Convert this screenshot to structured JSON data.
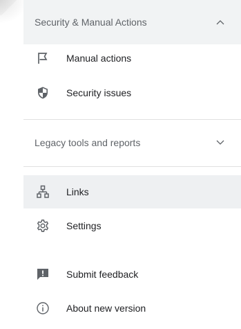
{
  "sections": {
    "security": {
      "title": "Security & Manual Actions",
      "state": "expanded",
      "items": [
        {
          "label": "Manual actions",
          "icon": "flag-icon"
        },
        {
          "label": "Security issues",
          "icon": "shield-icon"
        }
      ]
    },
    "legacy": {
      "title": "Legacy tools and reports",
      "state": "collapsed"
    }
  },
  "nav": {
    "links": {
      "label": "Links",
      "icon": "sitemap-icon",
      "active": true
    },
    "settings": {
      "label": "Settings",
      "icon": "gear-icon"
    },
    "feedback": {
      "label": "Submit feedback",
      "icon": "feedback-icon"
    },
    "about": {
      "label": "About new version",
      "icon": "info-icon"
    }
  },
  "colors": {
    "expanded_header_bg": "#f1f3f4",
    "active_item_bg": "#eef0f2",
    "text_primary": "#202124",
    "text_secondary": "#5f6368",
    "icon": "#5f6368",
    "divider": "#e0e0e0"
  }
}
